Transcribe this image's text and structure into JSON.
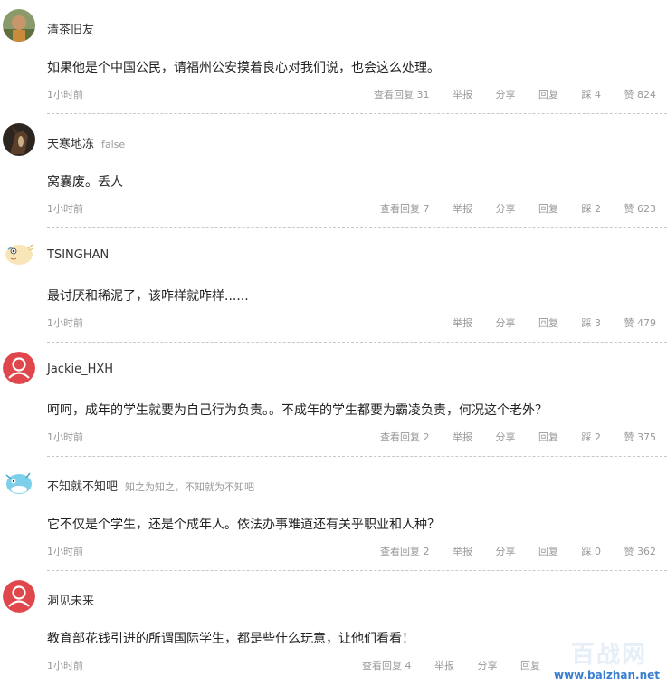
{
  "comments": [
    {
      "username": "清茶旧友",
      "signature": "",
      "content": "如果他是个中国公民，请福州公安摸着良心对我们说，也会这么处理。",
      "time": "1小时前",
      "view_replies": "查看回复 31",
      "report": "举报",
      "share": "分享",
      "reply": "回复",
      "dislike": "踩 4",
      "like": "赞 824",
      "avatar_icon": "elder-photo-avatar"
    },
    {
      "username": "天寒地冻",
      "signature": "false",
      "content": "窝囊废。丢人",
      "time": "1小时前",
      "view_replies": "查看回复 7",
      "report": "举报",
      "share": "分享",
      "reply": "回复",
      "dislike": "踩 2",
      "like": "赞 623",
      "avatar_icon": "horse-photo-avatar"
    },
    {
      "username": "TSINGHAN",
      "signature": "",
      "content": "最讨厌和稀泥了，该咋样就咋样......",
      "time": "1小时前",
      "view_replies": "",
      "report": "举报",
      "share": "分享",
      "reply": "回复",
      "dislike": "踩 3",
      "like": "赞 479",
      "avatar_icon": "pufferfish-avatar"
    },
    {
      "username": "Jackie_HXH",
      "signature": "",
      "content": "呵呵，成年的学生就要为自己行为负责。。不成年的学生都要为霸凌负责，何况这个老外？",
      "time": "1小时前",
      "view_replies": "查看回复 2",
      "report": "举报",
      "share": "分享",
      "reply": "回复",
      "dislike": "踩 2",
      "like": "赞 375",
      "avatar_icon": "default-user-avatar"
    },
    {
      "username": "不知就不知吧",
      "signature": "知之为知之，不知就为不知吧",
      "content": "它不仅是个学生，还是个成年人。依法办事难道还有关乎职业和人种？",
      "time": "1小时前",
      "view_replies": "查看回复 2",
      "report": "举报",
      "share": "分享",
      "reply": "回复",
      "dislike": "踩 0",
      "like": "赞 362",
      "avatar_icon": "fish-cartoon-avatar"
    },
    {
      "username": "洞见未来",
      "signature": "",
      "content": "教育部花钱引进的所谓国际学生，都是些什么玩意，让他们看看！",
      "time": "1小时前",
      "view_replies": "查看回复 4",
      "report": "举报",
      "share": "分享",
      "reply": "回复",
      "dislike": "",
      "like": "",
      "avatar_icon": "default-user-avatar"
    }
  ],
  "watermark": {
    "title": "百战网",
    "url": "www.baizhan.net"
  },
  "colors": {
    "default_avatar": "#e0474c",
    "meta_text": "#999999",
    "watermark_url": "#3a7fd0"
  }
}
